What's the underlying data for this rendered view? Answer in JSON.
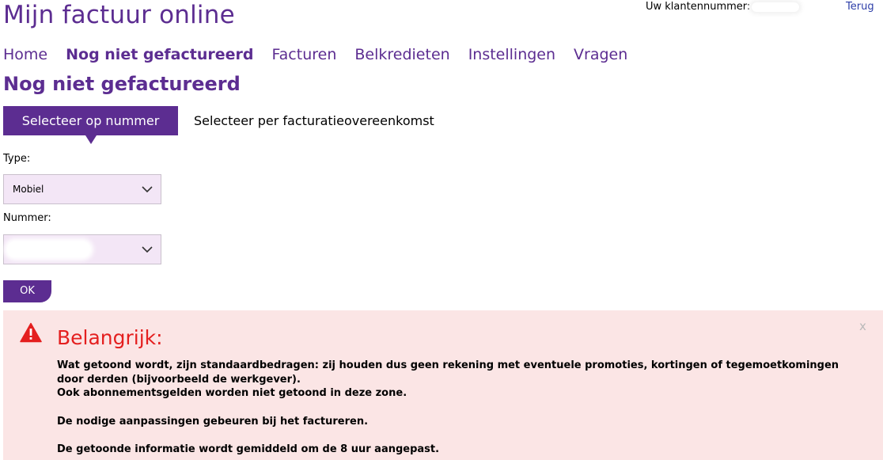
{
  "header": {
    "app_title": "Mijn factuur online",
    "customer_label": "Uw klantennummer:",
    "back_link": "Terug"
  },
  "nav": {
    "items": [
      {
        "label": "Home",
        "active": false
      },
      {
        "label": "Nog niet gefactureerd",
        "active": true
      },
      {
        "label": "Facturen",
        "active": false
      },
      {
        "label": "Belkredieten",
        "active": false
      },
      {
        "label": "Instellingen",
        "active": false
      },
      {
        "label": "Vragen",
        "active": false
      }
    ]
  },
  "page_title": "Nog niet gefactureerd",
  "segments": {
    "active": "Selecteer op nummer",
    "other": "Selecteer per facturatieovereenkomst"
  },
  "form": {
    "type_label": "Type:",
    "type_value": "Mobiel",
    "number_label": "Nummer:",
    "ok_label": "OK"
  },
  "alert": {
    "title": "Belangrijk:",
    "close": "x",
    "line1": "Wat getoond wordt, zijn standaardbedragen: zij houden dus geen rekening met eventuele promoties, kortingen of tegemoetkomingen door derden (bijvoorbeeld de werkgever).",
    "line2": "Ook abonnementsgelden worden niet getoond in deze zone.",
    "line3": "De nodige aanpassingen gebeuren bij het factureren.",
    "line4": "De getoonde informatie wordt gemiddeld om de 8 uur aangepast."
  },
  "colors": {
    "brand": "#5c2d91",
    "alert_bg": "#fbe5e5",
    "alert_title": "#e41f1f",
    "select_bg": "#f3e6f6",
    "link": "#2d3ea8"
  },
  "icons": {
    "warning": "warning-triangle-icon",
    "chevron": "chevron-down-icon"
  }
}
